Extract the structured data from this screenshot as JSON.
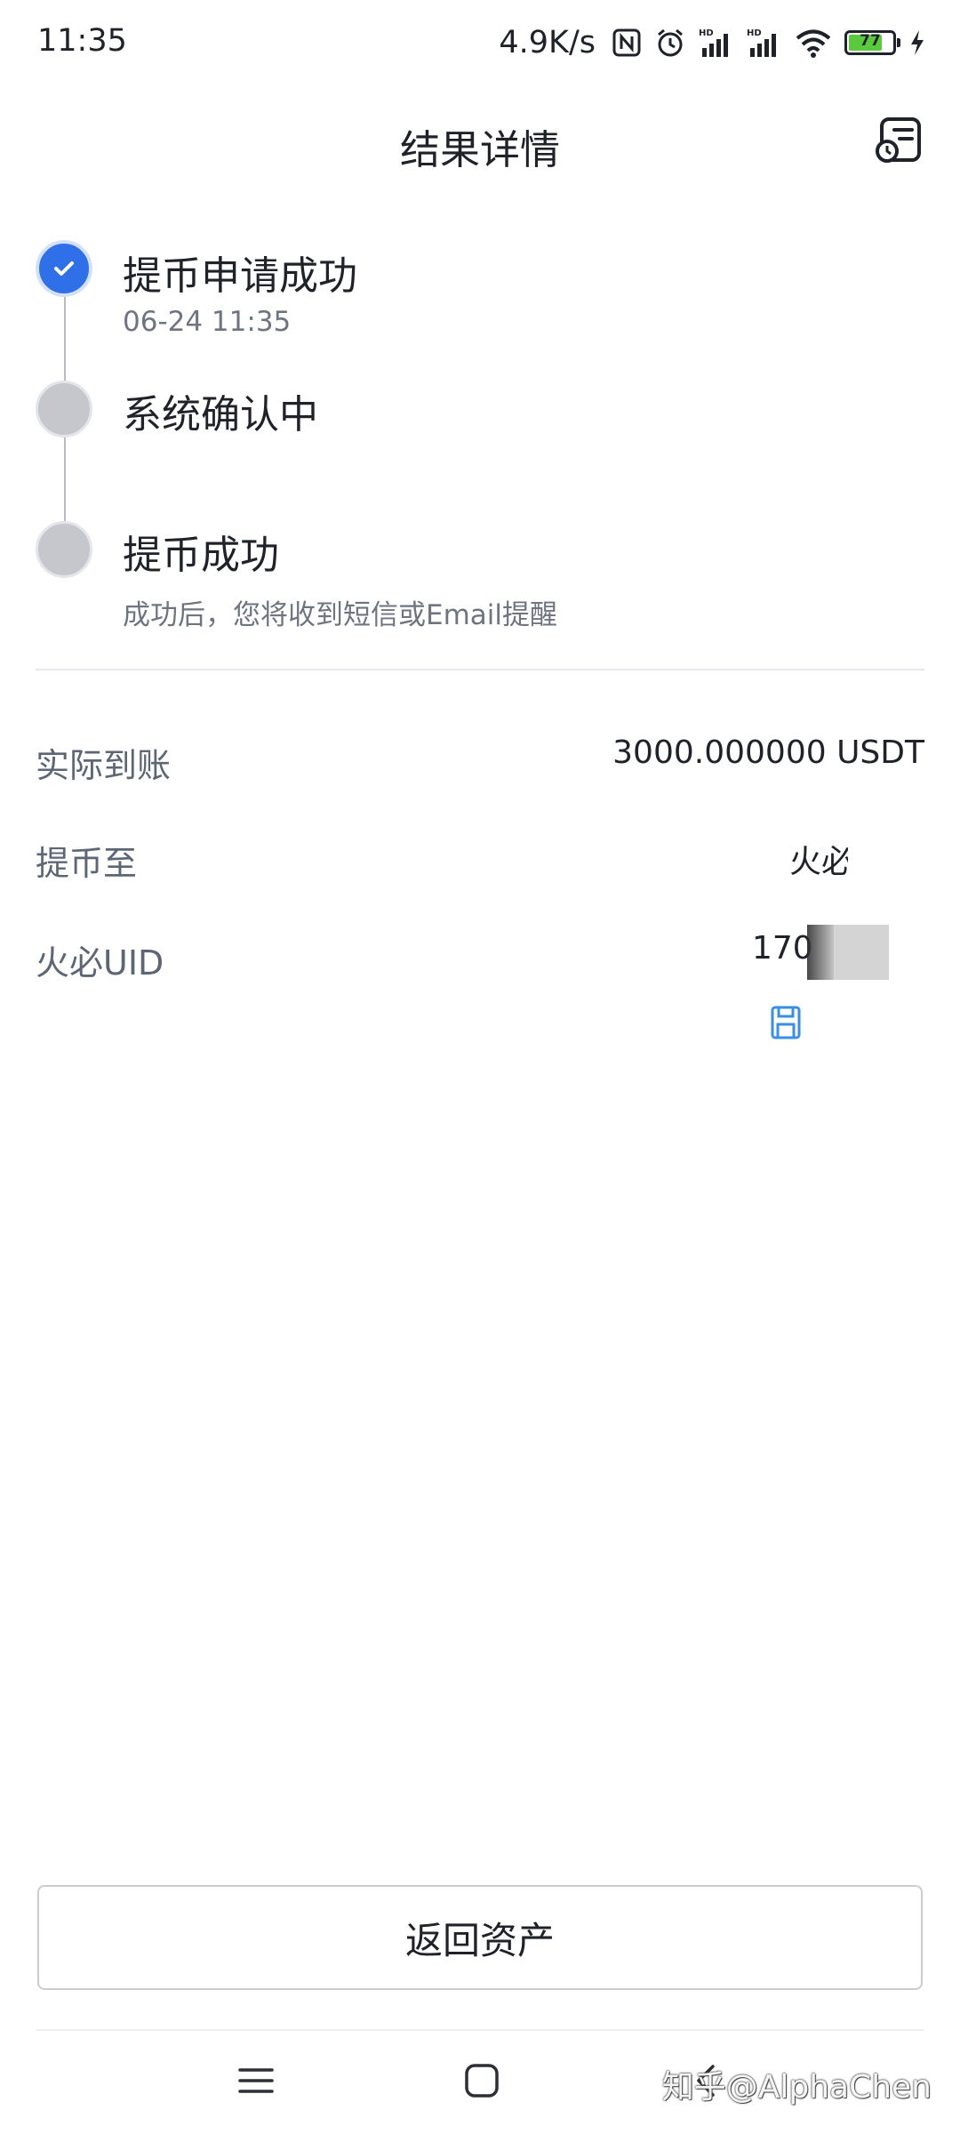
{
  "status_bar": {
    "time": "11:35",
    "net_speed": "4.9K/s",
    "battery_level": "77",
    "battery_percent": 77,
    "icons": [
      "nfc-icon",
      "alarm-icon",
      "signal-hd-1-icon",
      "signal-hd-2-icon",
      "wifi-icon",
      "battery-icon",
      "charging-icon"
    ]
  },
  "header": {
    "title": "结果详情",
    "record_icon": "record-list-icon"
  },
  "timeline": {
    "steps": [
      {
        "title": "提币申请成功",
        "subtitle": "06-24 11:35",
        "status": "done"
      },
      {
        "title": "系统确认中",
        "subtitle": "",
        "status": "pending"
      },
      {
        "title": "提币成功",
        "subtitle": "成功后，您将收到短信或Email提醒",
        "status": "pending"
      }
    ]
  },
  "details": {
    "received_label": "实际到账",
    "received_value": "3000.000000 USDT",
    "withdraw_to_label": "提币至",
    "withdraw_to_value": "火必",
    "uid_label": "火必UID",
    "uid_value": "170",
    "uid_copy_icon": "copy-icon"
  },
  "actions": {
    "back_label": "返回资产"
  },
  "nav": {
    "icons": [
      "menu-icon",
      "home-icon",
      "back-icon"
    ]
  },
  "watermark": "知乎@AlphaChen",
  "colors": {
    "accent": "#2f70e8",
    "pending_dot": "#c5c7cd",
    "battery_fill": "#5ac93e",
    "copy_icon": "#3a8ee6"
  }
}
